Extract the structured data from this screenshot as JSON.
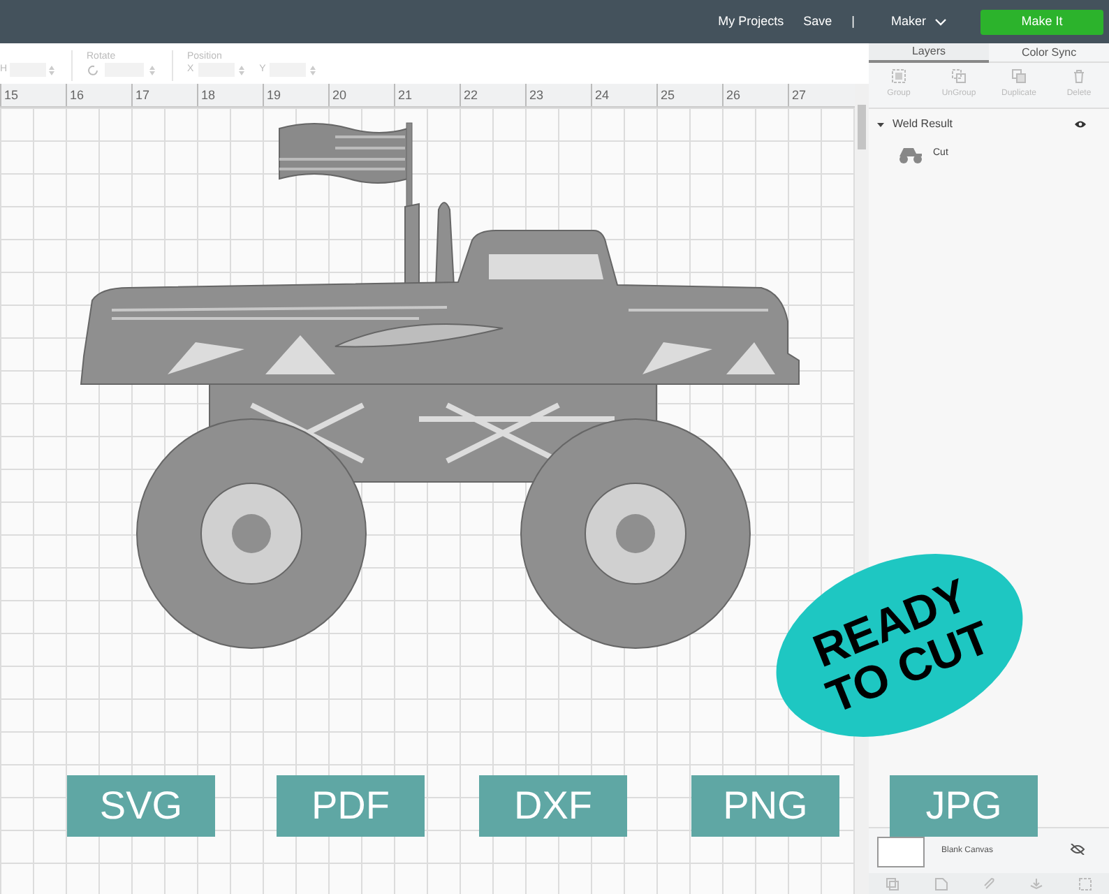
{
  "top_bar": {
    "links": [
      "My Projects",
      "Save"
    ],
    "separator": "|",
    "machine": "Maker",
    "make_it": "Make It"
  },
  "toolbar": {
    "size_label": "H",
    "rotate_label": "Rotate",
    "position_label": "Position",
    "x_label": "X",
    "y_label": "Y"
  },
  "ruler": [
    "15",
    "16",
    "17",
    "18",
    "19",
    "20",
    "21",
    "22",
    "23",
    "24",
    "25",
    "26",
    "27"
  ],
  "panel": {
    "tabs": [
      {
        "label": "Layers",
        "selected": true
      },
      {
        "label": "Color Sync",
        "selected": false
      }
    ],
    "actions": [
      "Group",
      "UnGroup",
      "Duplicate",
      "Delete"
    ],
    "layers": [
      {
        "name": "Weld Result",
        "expanded": true,
        "children": [
          {
            "name": "Cut"
          }
        ]
      }
    ],
    "canvas_label": "Blank Canvas"
  },
  "badge": "READY TO CUT",
  "formats": [
    "SVG",
    "PDF",
    "DXF",
    "PNG",
    "JPG"
  ]
}
